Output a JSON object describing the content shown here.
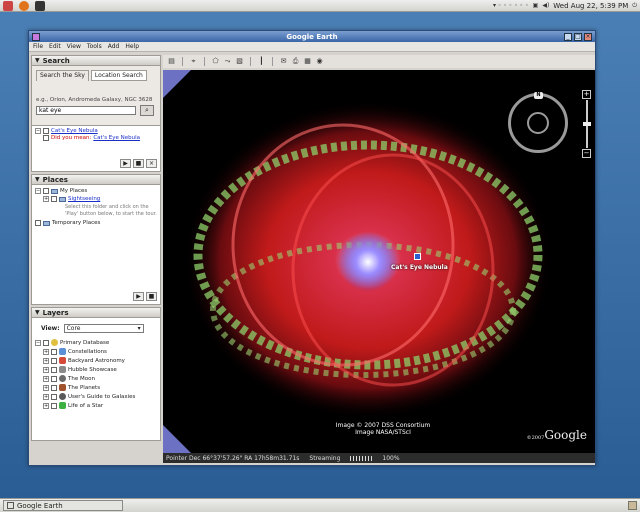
{
  "top_panel": {
    "clock": "Wed Aug 22,  5:39 PM"
  },
  "window": {
    "title": "Google Earth",
    "menu": [
      "File",
      "Edit",
      "View",
      "Tools",
      "Add",
      "Help"
    ]
  },
  "search": {
    "header": "Search",
    "tabs": [
      "Search the Sky",
      "Location Search"
    ],
    "hint": "e.g., Orion, Andromeda Galaxy, NGC 3628",
    "query": "kat eye",
    "results": [
      {
        "label": "Cat's Eye Nebula",
        "checked": true
      },
      {
        "prefix": "Did you mean:",
        "label": "Cat's Eye Nebula"
      }
    ]
  },
  "places": {
    "header": "Places",
    "items": {
      "my_places": "My Places",
      "sightseeing": "Sightseeing",
      "sightseeing_desc": "Select this folder and click on the 'Play' button below, to start the tour.",
      "temporary": "Temporary Places"
    }
  },
  "layers": {
    "header": "Layers",
    "view_label": "View:",
    "view_value": "Core",
    "root": "Primary Database",
    "items": [
      {
        "label": "Constellations",
        "color": "#5b8fd6"
      },
      {
        "label": "Backyard Astronomy",
        "color": "#d64a3a"
      },
      {
        "label": "Hubble Showcase",
        "color": "#8a8a8a"
      },
      {
        "label": "The Moon",
        "color": "#6b6b6b"
      },
      {
        "label": "The Planets",
        "color": "#a0522d"
      },
      {
        "label": "User's Guide to Galaxies",
        "color": "#5a5a5a"
      },
      {
        "label": "Life of a Star",
        "color": "#3cb043"
      }
    ]
  },
  "view3d": {
    "placemark_label": "Cat's Eye Nebula",
    "credit_line1": "Image © 2007 DSS Consortium",
    "credit_line2": "Image NASA/STScI",
    "logo_small": "©2007",
    "logo": "Google",
    "north": "N"
  },
  "status": {
    "pointer": "Pointer  Dec  66°37'57.26\"   RA  17h58m31.71s",
    "streaming": "Streaming",
    "percent": "100%"
  },
  "taskbar": {
    "item": "Google Earth"
  }
}
